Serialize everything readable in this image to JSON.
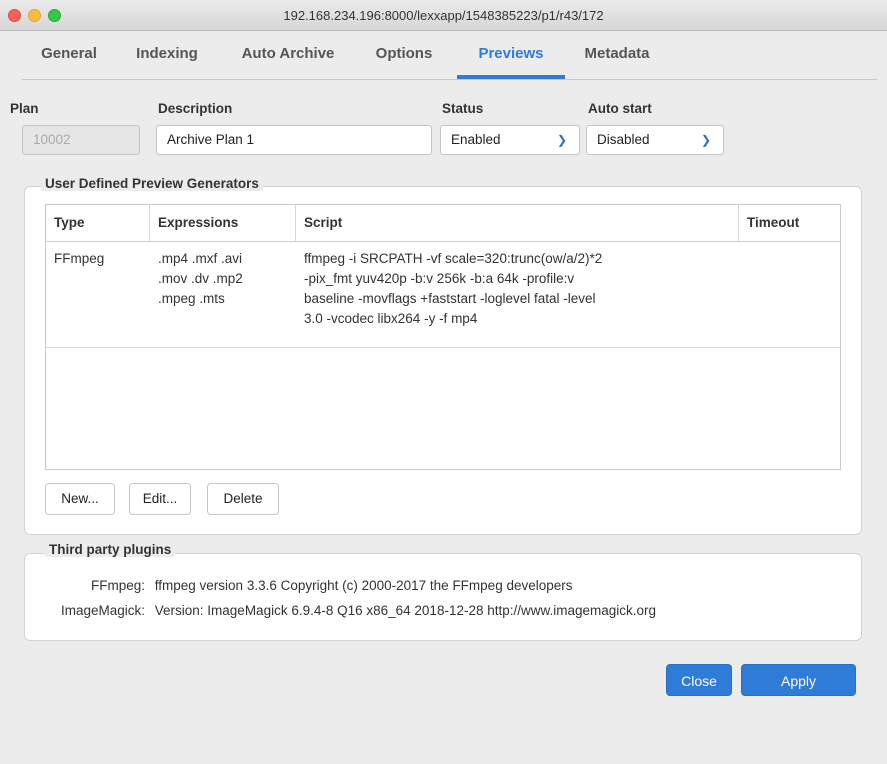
{
  "window": {
    "title": "192.168.234.196:8000/lexxapp/1548385223/p1/r43/172"
  },
  "tabs": [
    {
      "label": "General"
    },
    {
      "label": "Indexing"
    },
    {
      "label": "Auto Archive"
    },
    {
      "label": "Options"
    },
    {
      "label": "Previews",
      "active": true
    },
    {
      "label": "Metadata"
    }
  ],
  "form": {
    "plan_label": "Plan",
    "plan_value": "10002",
    "description_label": "Description",
    "description_value": "Archive Plan  1",
    "status_label": "Status",
    "status_value": "Enabled",
    "autostart_label": "Auto start",
    "autostart_value": "Disabled"
  },
  "generators": {
    "title": "User Defined Preview Generators",
    "columns": [
      "Type",
      "Expressions",
      "Script",
      "Timeout"
    ],
    "rows": [
      {
        "type": "FFmpeg",
        "expressions": [
          ".mp4 .mxf .avi",
          ".mov .dv .mp2",
          ".mpeg .mts"
        ],
        "script": [
          "ffmpeg -i SRCPATH -vf scale=320:trunc(ow/a/2)*2",
          "-pix_fmt yuv420p -b:v 256k -b:a 64k -profile:v",
          "baseline -movflags +faststart -loglevel fatal -level",
          "3.0 -vcodec libx264 -y -f mp4"
        ],
        "timeout": ""
      }
    ],
    "buttons": {
      "new": "New...",
      "edit": "Edit...",
      "delete": "Delete"
    }
  },
  "plugins": {
    "title": "Third party plugins",
    "items": [
      {
        "name": "FFmpeg:",
        "value": "ffmpeg version 3.3.6 Copyright (c) 2000-2017 the FFmpeg developers"
      },
      {
        "name": "ImageMagick:",
        "value": "Version: ImageMagick 6.9.4-8 Q16 x86_64 2018-12-28 http://www.imagemagick.org"
      }
    ]
  },
  "footer": {
    "close_label": "Close",
    "apply_label": "Apply"
  },
  "colors": {
    "accent": "#2f7bd8",
    "close_traffic": "#fc605b",
    "min_traffic": "#fdbc40",
    "max_traffic": "#34c84a"
  }
}
